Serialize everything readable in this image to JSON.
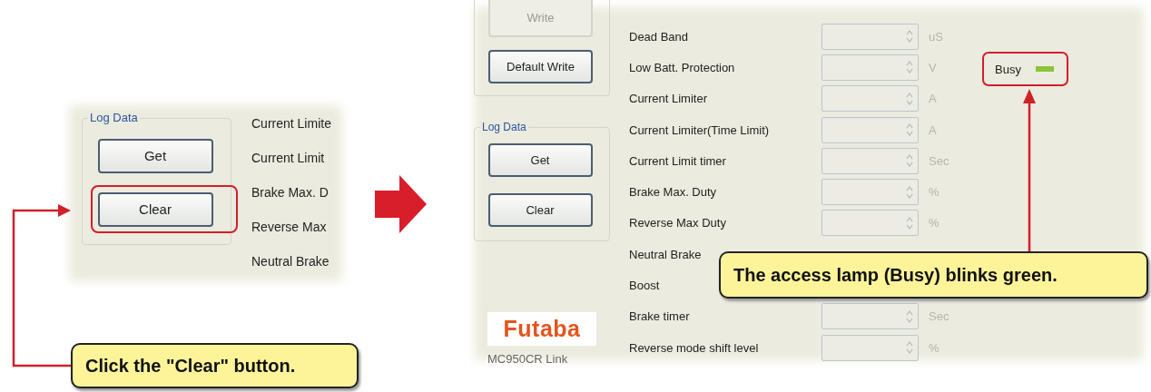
{
  "left_panel": {
    "group": {
      "title": "Log Data",
      "buttons": [
        {
          "label": "Get",
          "highlighted": false
        },
        {
          "label": "Clear",
          "highlighted": true
        }
      ]
    },
    "labels": [
      "Current Limite",
      "Current Limit",
      "Brake Max. D",
      "Reverse Max",
      "Neutral Brake"
    ]
  },
  "right_panel": {
    "buttons": [
      {
        "label": "Write",
        "disabled": true
      },
      {
        "label": "Default Write",
        "disabled": false
      }
    ],
    "group": {
      "title": "Log Data",
      "buttons": [
        {
          "label": "Get",
          "highlighted": false
        },
        {
          "label": "Clear",
          "highlighted": false
        }
      ]
    },
    "logo": "Futaba",
    "app_name": "MC950CR Link",
    "rows": [
      {
        "label": "Dead Band",
        "unit": "uS"
      },
      {
        "label": "Low Batt. Protection",
        "unit": "V"
      },
      {
        "label": "Current Limiter",
        "unit": "A"
      },
      {
        "label": "Current Limiter(Time Limit)",
        "unit": "A"
      },
      {
        "label": "Current Limit timer",
        "unit": "Sec"
      },
      {
        "label": "Brake Max. Duty",
        "unit": "%"
      },
      {
        "label": "Reverse Max Duty",
        "unit": "%"
      },
      {
        "label": "Neutral Brake"
      },
      {
        "label": "Boost"
      },
      {
        "label": "Brake timer",
        "unit": "Sec"
      },
      {
        "label": "Reverse mode shift level",
        "unit": "%"
      }
    ],
    "busy": {
      "label": "Busy",
      "on": true,
      "highlighted": true
    }
  },
  "callouts": [
    {
      "text": "Click the \"Clear\" button."
    },
    {
      "text": "The access lamp (Busy) blinks green."
    }
  ]
}
